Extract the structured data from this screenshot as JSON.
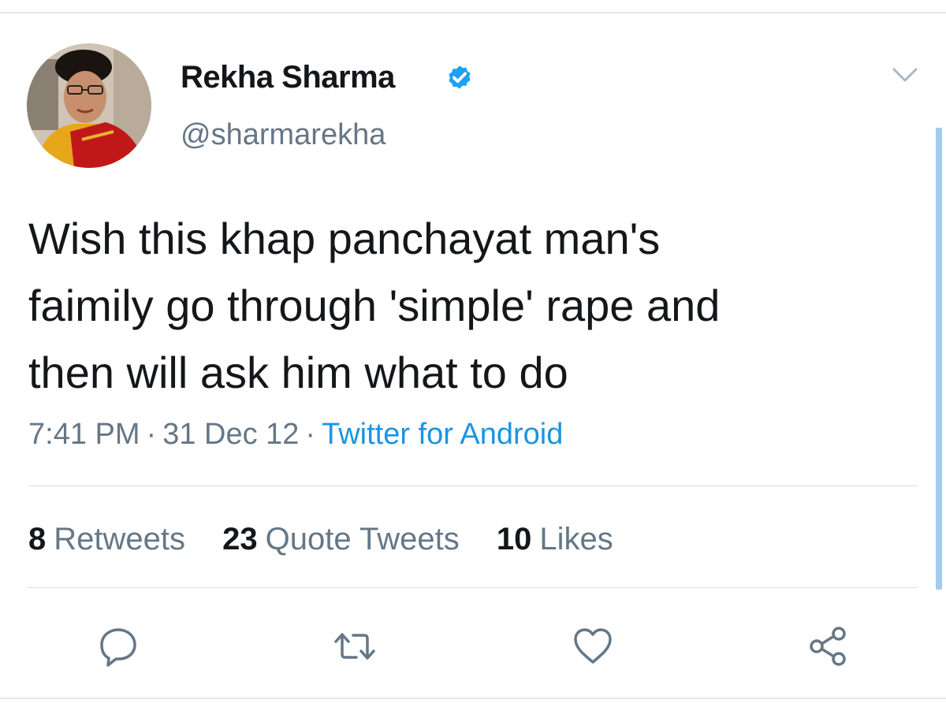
{
  "user": {
    "display_name": "Rekha Sharma",
    "handle": "@sharmarekha",
    "verified": true,
    "avatar_icon": "profile-photo"
  },
  "tweet": {
    "lines": [
      "Wish this khap panchayat man's",
      "faimily go through 'simple' rape and",
      "then will ask him what to do"
    ],
    "time": "7:41 PM",
    "date": "31 Dec 12",
    "separator": "·",
    "source": "Twitter for Android"
  },
  "stats": {
    "retweets_count": "8",
    "retweets_label": "Retweets",
    "quotes_count": "23",
    "quotes_label": "Quote Tweets",
    "likes_count": "10",
    "likes_label": "Likes"
  },
  "actions": {
    "reply_icon": "reply-icon",
    "retweet_icon": "retweet-icon",
    "like_icon": "heart-icon",
    "share_icon": "share-icon"
  },
  "colors": {
    "accent": "#1b95e0",
    "verified": "#1da1f2",
    "secondary_text": "#657786",
    "primary_text": "#14171a",
    "divider": "#e1e8ed"
  }
}
